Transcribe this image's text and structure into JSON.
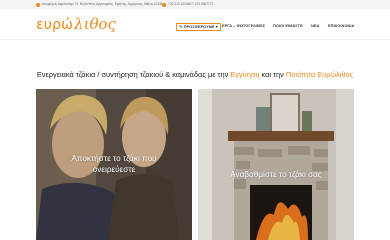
{
  "topbar": {
    "address": "Λεωφόρος Ακρόπολης 74, Βυζαντινός Αρμπορείος, Ειρήνης, Αρμόρνας, Αθήνα 12345",
    "phone": "+30 210 1234567, 123 4567777"
  },
  "logo": {
    "part1": "ευρώ",
    "part2": "λιθος"
  },
  "nav": {
    "items": [
      "ΤΙ ΠΡΟΣΦΕΡΟΥΜΕ ▾",
      "ΕΡΓΑ – ΦΩΤΟΓΡΑΦΙΕΣ",
      "ΠΟΙΟΙ ΕΙΜΑΣΤΕ",
      "ΝΕΑ",
      "ΕΠΙΚΟΙΝΩΝΙΑ"
    ]
  },
  "headline": {
    "part1": "Ενεργειακά τζάκια / συντήρηση τζακιού & καμινάδας με την ",
    "hl1": "Εγγύηση",
    "part2": " και την ",
    "hl2": "Ποιότητα",
    "part3": " ",
    "hl3": "Ευρώλιθος"
  },
  "cards": [
    {
      "line1": "Αποκτήστε το τζάκι που",
      "line2": "ονειρεύεστε"
    },
    {
      "line1": "Αναβαθμίστε το τζάκι σας",
      "line2": ""
    }
  ],
  "colors": {
    "accent": "#f08a1c",
    "text": "#222222",
    "topbar_bg": "#f4f4f4"
  },
  "icons": [
    "location-icon",
    "phone-icon"
  ]
}
